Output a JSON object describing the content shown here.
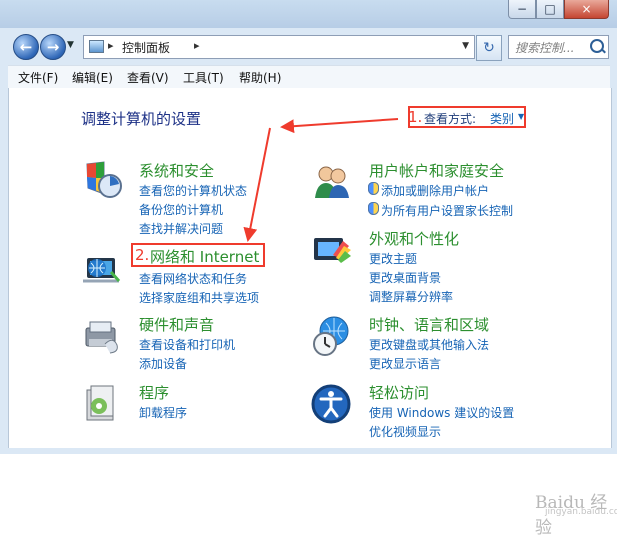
{
  "address": {
    "location": "控制面板",
    "search_placeholder": "搜索控制..."
  },
  "menu": [
    "文件(F)",
    "编辑(E)",
    "查看(V)",
    "工具(T)",
    "帮助(H)"
  ],
  "page": {
    "title": "调整计算机的设置",
    "view_by_label": "查看方式:",
    "view_by_value": "类别",
    "annotation1": "1.",
    "annotation2": "2."
  },
  "categories": [
    {
      "title": "系统和安全",
      "links": [
        "查看您的计算机状态",
        "备份您的计算机",
        "查找并解决问题"
      ]
    },
    {
      "title": "网络和 Internet",
      "links": [
        "查看网络状态和任务",
        "选择家庭组和共享选项"
      ]
    },
    {
      "title": "硬件和声音",
      "links": [
        "查看设备和打印机",
        "添加设备"
      ]
    },
    {
      "title": "程序",
      "links": [
        "卸载程序"
      ]
    },
    {
      "title": "用户帐户和家庭安全",
      "links": [
        "添加或删除用户帐户",
        "为所有用户设置家长控制"
      ]
    },
    {
      "title": "外观和个性化",
      "links": [
        "更改主题",
        "更改桌面背景",
        "调整屏幕分辨率"
      ]
    },
    {
      "title": "时钟、语言和区域",
      "links": [
        "更改键盘或其他输入法",
        "更改显示语言"
      ]
    },
    {
      "title": "轻松访问",
      "links": [
        "使用 Windows 建议的设置",
        "优化视频显示"
      ]
    }
  ],
  "watermark": {
    "logo": "Baidu 经验",
    "url": "jingyan.baidu.com"
  }
}
